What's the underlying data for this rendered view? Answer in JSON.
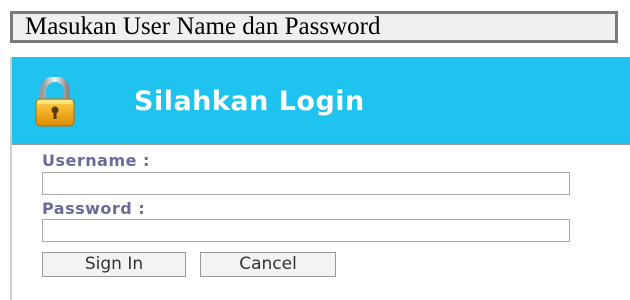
{
  "banner": {
    "text": "Masukan User Name dan Password"
  },
  "login": {
    "title": "Silahkan Login",
    "header_color": "#1ec3f0",
    "icon": "lock-icon",
    "username": {
      "label": "Username :",
      "value": "",
      "placeholder": ""
    },
    "password": {
      "label": "Password :",
      "value": "",
      "placeholder": ""
    },
    "buttons": {
      "sign_in": "Sign In",
      "cancel": "Cancel"
    }
  }
}
